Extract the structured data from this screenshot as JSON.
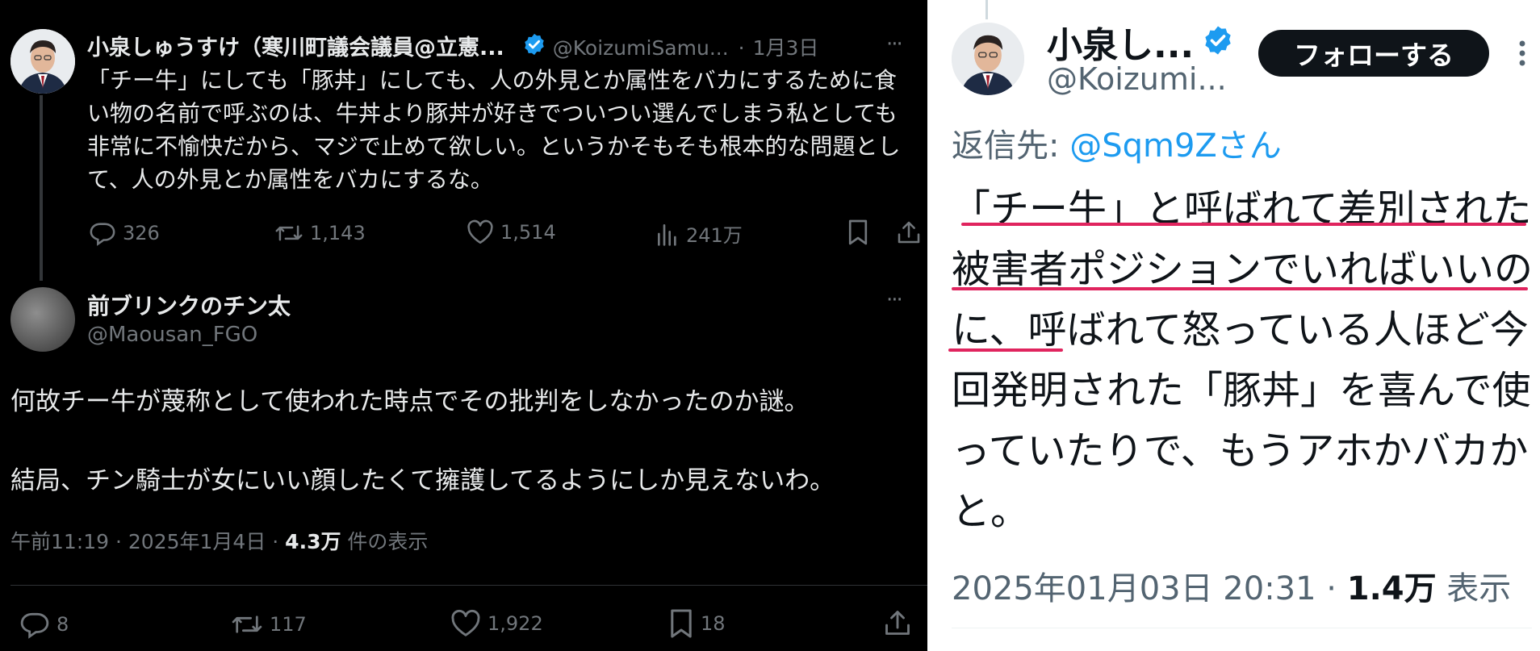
{
  "left": {
    "original": {
      "name": "小泉しゅうすけ（寒川町議会議員@立憲...",
      "handle": "@KoizumiSamu...",
      "sep": "·",
      "date": "1月3日",
      "more": "···",
      "text": "「チー牛」にしても「豚丼」にしても、人の外見とか属性をバカにするために食い物の名前で呼ぶのは、牛丼より豚丼が好きでついつい選んでしまう私としても非常に不愉快だから、マジで止めて欲しい。というかそもそも根本的な問題として、人の外見とか属性をバカにするな。",
      "actions": {
        "replies": "326",
        "reposts": "1,143",
        "likes": "1,514",
        "views": "241万"
      }
    },
    "reply": {
      "name": "前ブリンクのチン太",
      "handle": "@Maousan_FGO",
      "more": "···",
      "line1": "何故チー牛が蔑称として使われた時点でその批判をしなかったのか謎。",
      "line2": "結局、チン騎士が女にいい顔したくて擁護してるようにしか見えないわ。",
      "meta_time": "午前11:19 · 2025年1月4日 · ",
      "meta_views": "4.3万",
      "meta_suffix": " 件の表示",
      "actions": {
        "replies": "8",
        "reposts": "117",
        "likes": "1,922",
        "bookmarks": "18"
      }
    }
  },
  "right": {
    "name": "小泉し...",
    "handle": "@Koizumi...",
    "follow_label": "フォローする",
    "reply_to_prefix": "返信先: ",
    "reply_to_handle": "@Sqm9Zさん",
    "text": "「チー牛」と呼ばれて差別された被害者ポジションでいればいいのに、呼ばれて怒っている人ほど今回発明された「豚丼」を喜んで使っていたりで、もうアホかバカかと。",
    "meta_time": "2025年01月03日 20:31 · ",
    "meta_views": "1.4万",
    "meta_suffix": " 表示"
  },
  "colors": {
    "verified": "#1d9bf0",
    "link": "#1d9bf0",
    "underline": "#e0245e",
    "dark_bg": "#000000"
  }
}
